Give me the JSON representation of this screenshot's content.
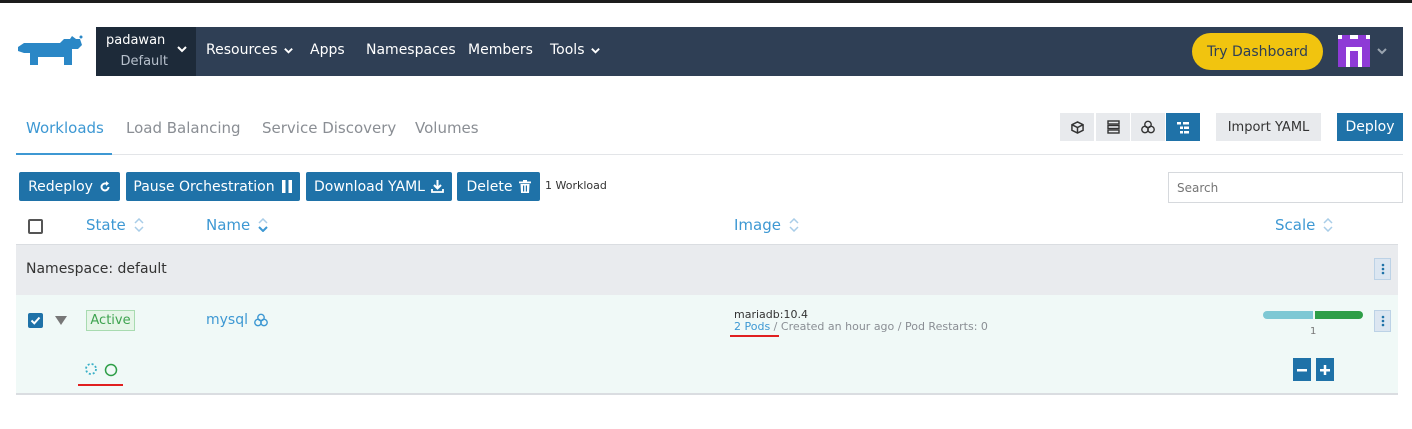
{
  "header": {
    "project": "padawan",
    "namespace": "Default",
    "nav": [
      "Resources",
      "Apps",
      "Namespaces",
      "Members",
      "Tools"
    ],
    "try_dashboard": "Try Dashboard"
  },
  "tabs": [
    "Workloads",
    "Load Balancing",
    "Service Discovery",
    "Volumes"
  ],
  "toolbar": {
    "import_yaml": "Import YAML",
    "deploy": "Deploy"
  },
  "actions": {
    "redeploy": "Redeploy",
    "pause": "Pause Orchestration",
    "download": "Download YAML",
    "delete": "Delete",
    "count": "1 Workload"
  },
  "search": {
    "placeholder": "Search"
  },
  "table": {
    "columns": {
      "state": "State",
      "name": "Name",
      "image": "Image",
      "scale": "Scale"
    },
    "group_label": "Namespace: default",
    "row": {
      "state": "Active",
      "name": "mysql",
      "image": "mariadb:10.4",
      "pods": "2 Pods",
      "meta": " / Created an hour ago / Pod Restarts: 0",
      "scale": "1",
      "scale_fill": 0.5
    }
  },
  "colors": {
    "accent": "#3d98d3",
    "button": "#1f72a8",
    "navbar": "#2f3f55",
    "active": "#3ea34f",
    "annotation": "#e02020"
  }
}
